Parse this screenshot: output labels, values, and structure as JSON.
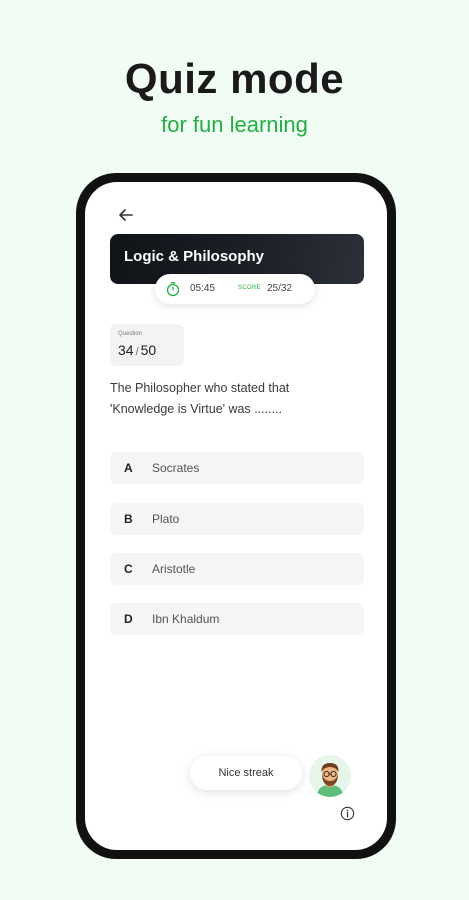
{
  "promo": {
    "headline": "Quiz mode",
    "subheadline": "for fun learning",
    "accent_color": "#23b043"
  },
  "quiz": {
    "back_icon": "arrow-left-icon",
    "title": "Logic & Philosophy",
    "timer_icon": "stopwatch-icon",
    "timer": "05:45",
    "score_label": "SCORE",
    "score": "25/32",
    "question_label": "Question",
    "question_current": "34",
    "question_separator": "/",
    "question_total": "50",
    "question_text": "The Philosopher who stated that 'Knowledge is Virtue' was ........",
    "options": [
      {
        "letter": "A",
        "text": "Socrates"
      },
      {
        "letter": "B",
        "text": "Plato"
      },
      {
        "letter": "C",
        "text": "Aristotle"
      },
      {
        "letter": "D",
        "text": "Ibn Khaldum"
      }
    ],
    "streak_message": "Nice streak",
    "avatar_icon": "avatar-icon",
    "info_icon": "info-icon"
  }
}
